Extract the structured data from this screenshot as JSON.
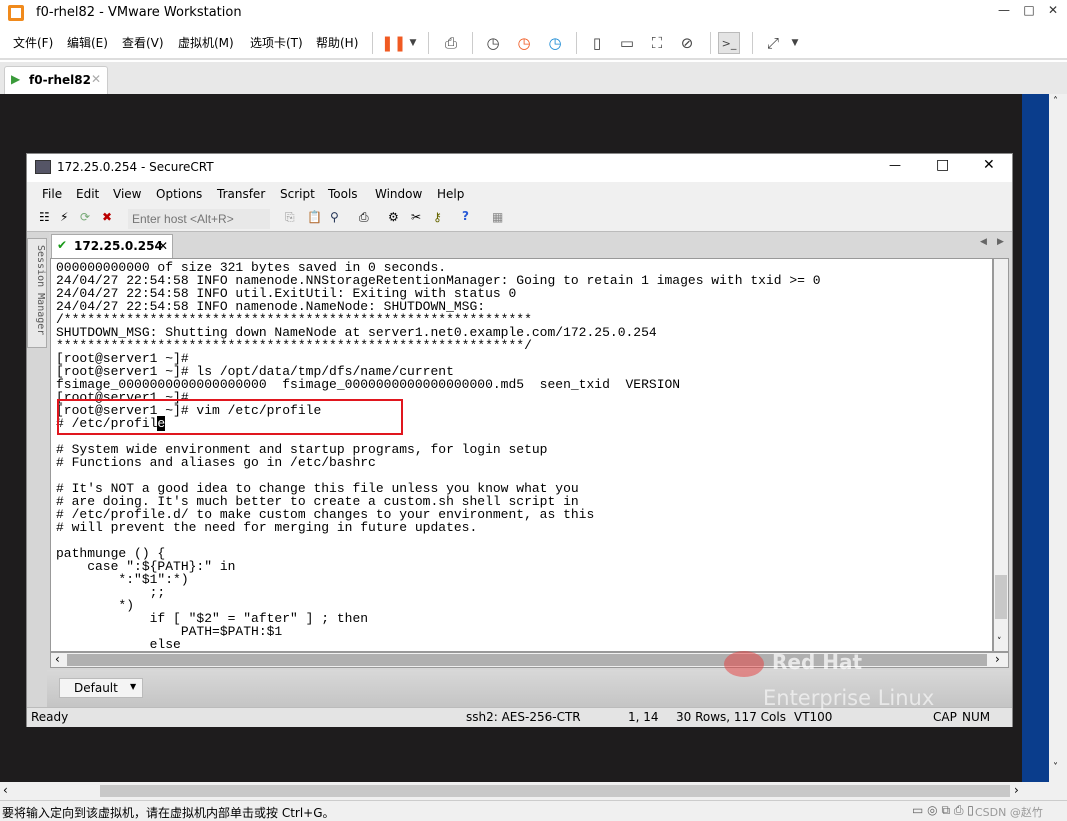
{
  "vmware": {
    "title": "f0-rhel82 - VMware Workstation",
    "menu": [
      "文件(F)",
      "编辑(E)",
      "查看(V)",
      "虚拟机(M)",
      "选项卡(T)",
      "帮助(H)"
    ],
    "tab": "f0-rhel82",
    "status": "要将输入定向到该虚拟机，请在虚拟机内部单击或按 Ctrl+G。",
    "watermark": "CSDN @赵竹"
  },
  "securecrt": {
    "title": "172.25.0.254 - SecureCRT",
    "menu": [
      "File",
      "Edit",
      "View",
      "Options",
      "Transfer",
      "Script",
      "Tools",
      "Window",
      "Help"
    ],
    "host_placeholder": "Enter host <Alt+R>",
    "tab": "172.25.0.254",
    "session_manager": "Session Manager",
    "terminal_lines": [
      "000000000000 of size 321 bytes saved in 0 seconds.",
      "24/04/27 22:54:58 INFO namenode.NNStorageRetentionManager: Going to retain 1 images with txid >= 0",
      "24/04/27 22:54:58 INFO util.ExitUtil: Exiting with status 0",
      "24/04/27 22:54:58 INFO namenode.NameNode: SHUTDOWN_MSG:",
      "/************************************************************",
      "SHUTDOWN_MSG: Shutting down NameNode at server1.net0.example.com/172.25.0.254",
      "************************************************************/",
      "[root@server1 ~]#",
      "[root@server1 ~]# ls /opt/data/tmp/dfs/name/current",
      "fsimage_0000000000000000000  fsimage_0000000000000000000.md5  seen_txid  VERSION",
      "[root@server1 ~]#",
      "[root@server1 ~]# vim /etc/profile"
    ],
    "cursor_line_before": "# /etc/profil",
    "cursor_char": "e",
    "file_lines": [
      "",
      "# System wide environment and startup programs, for login setup",
      "# Functions and aliases go in /etc/bashrc",
      "",
      "# It's NOT a good idea to change this file unless you know what you",
      "# are doing. It's much better to create a custom.sh shell script in",
      "# /etc/profile.d/ to make custom changes to your environment, as this",
      "# will prevent the need for merging in future updates.",
      "",
      "pathmunge () {",
      "    case \":${PATH}:\" in",
      "        *:\"$1\":*)",
      "            ;;",
      "        *)",
      "            if [ \"$2\" = \"after\" ] ; then",
      "                PATH=$PATH:$1",
      "            else"
    ],
    "button_bar": "Default",
    "status": {
      "ready": "Ready",
      "cipher": "ssh2: AES-256-CTR",
      "pos": "1, 14",
      "size": "30 Rows, 117 Cols",
      "term": "VT100",
      "cap": "CAP",
      "num": "NUM"
    }
  },
  "overlay": {
    "brand": "Red Hat",
    "product": "Enterprise Linux"
  },
  "colors": {
    "highlight": "#e0161e",
    "pause": "#f05a22",
    "vm_bg": "#1e1c1d"
  }
}
